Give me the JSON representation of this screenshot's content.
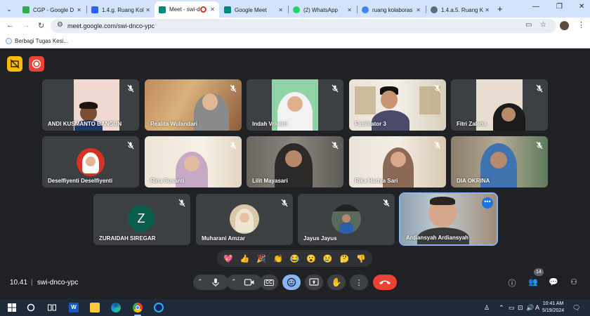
{
  "browser": {
    "tabs": [
      {
        "label": "CGP - Google D",
        "fav_color": "#34a853",
        "active": false
      },
      {
        "label": "1.4.g. Ruang Kol",
        "fav_color": "#2962ff",
        "active": false
      },
      {
        "label": "Meet - swi-d",
        "fav_color": "#00897b",
        "active": true
      },
      {
        "label": "Google Meet",
        "fav_color": "#00897b",
        "active": false
      },
      {
        "label": "(2) WhatsApp",
        "fav_color": "#25d366",
        "active": false
      },
      {
        "label": "ruang kolaboras",
        "fav_color": "#4285f4",
        "active": false
      },
      {
        "label": "1.4.a.5. Ruang K",
        "fav_color": "#546e7a",
        "active": false
      }
    ],
    "url": "meet.google.com/swi-dnco-ypc",
    "bookmark": "Berbagi Tugas Kesi..."
  },
  "meeting": {
    "time": "10.41",
    "code": "swi-dnco-ypc",
    "participant_count": "14",
    "participants": [
      {
        "name": "ANDI KUSMANTO BANGUN"
      },
      {
        "name": "Realita Wulandari"
      },
      {
        "name": "Indah Vriwitri"
      },
      {
        "name": "Fasilitator 3"
      },
      {
        "name": "Fitri Zaleha"
      },
      {
        "name": "Deselfiyenti Deselfiyenti"
      },
      {
        "name": "Rina Susanti"
      },
      {
        "name": "Lilit Mayasari"
      },
      {
        "name": "Rika Hartya Sari"
      },
      {
        "name": "DIA OKRINA"
      },
      {
        "name": "ZURAIDAH SIREGAR",
        "initial": "Z"
      },
      {
        "name": "Muharani Amzar"
      },
      {
        "name": "Jayus Jayus"
      },
      {
        "name": "Ardiansyah Ardiansyah"
      }
    ],
    "reactions": [
      "💖",
      "👍",
      "🎉",
      "👏",
      "😂",
      "😮",
      "😢",
      "🤔",
      "👎"
    ],
    "controls": {
      "cc": "CC"
    }
  },
  "system": {
    "clock_time": "10:41 AM",
    "clock_date": "5/19/2024",
    "ime": "A"
  }
}
